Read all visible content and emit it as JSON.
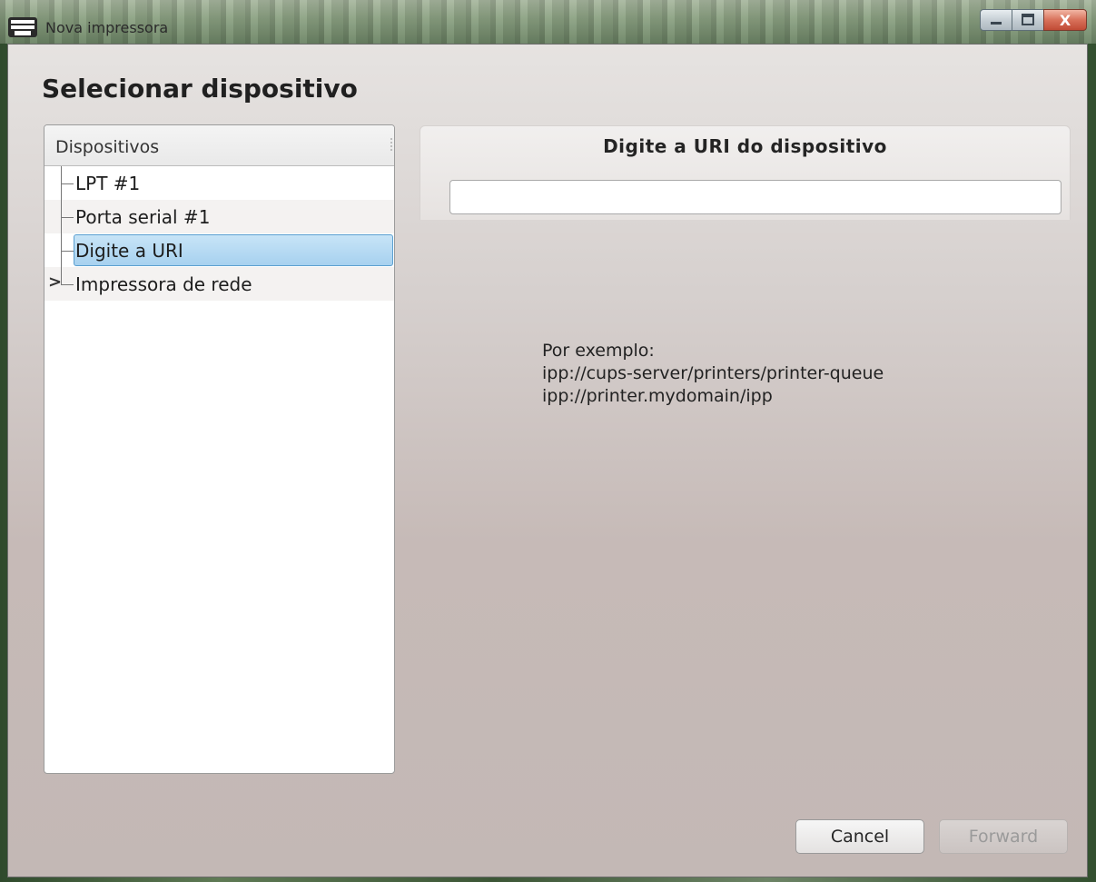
{
  "window": {
    "title": "Nova impressora",
    "icons": {
      "app": "printer-icon",
      "minimize": "minimize-icon",
      "maximize": "maximize-icon",
      "close": "close-icon"
    },
    "close_label": "X"
  },
  "page": {
    "heading": "Selecionar dispositivo"
  },
  "devices": {
    "header": "Dispositivos",
    "items": [
      {
        "label": "LPT #1",
        "selected": false,
        "expandable": false
      },
      {
        "label": "Porta serial #1",
        "selected": false,
        "expandable": false
      },
      {
        "label": "Digite a URI",
        "selected": true,
        "expandable": false
      },
      {
        "label": "Impressora de rede",
        "selected": false,
        "expandable": true,
        "expander": ">"
      }
    ]
  },
  "uri": {
    "title": "Digite a URI do dispositivo",
    "value": "",
    "placeholder": ""
  },
  "example": {
    "line1": "Por exemplo:",
    "line2": "ipp://cups-server/printers/printer-queue",
    "line3": "ipp://printer.mydomain/ipp"
  },
  "buttons": {
    "cancel": "Cancel",
    "forward": "Forward"
  },
  "colors": {
    "selection": "#a7d1ef",
    "selection_border": "#5a9fd0",
    "close_button": "#c04b35"
  }
}
